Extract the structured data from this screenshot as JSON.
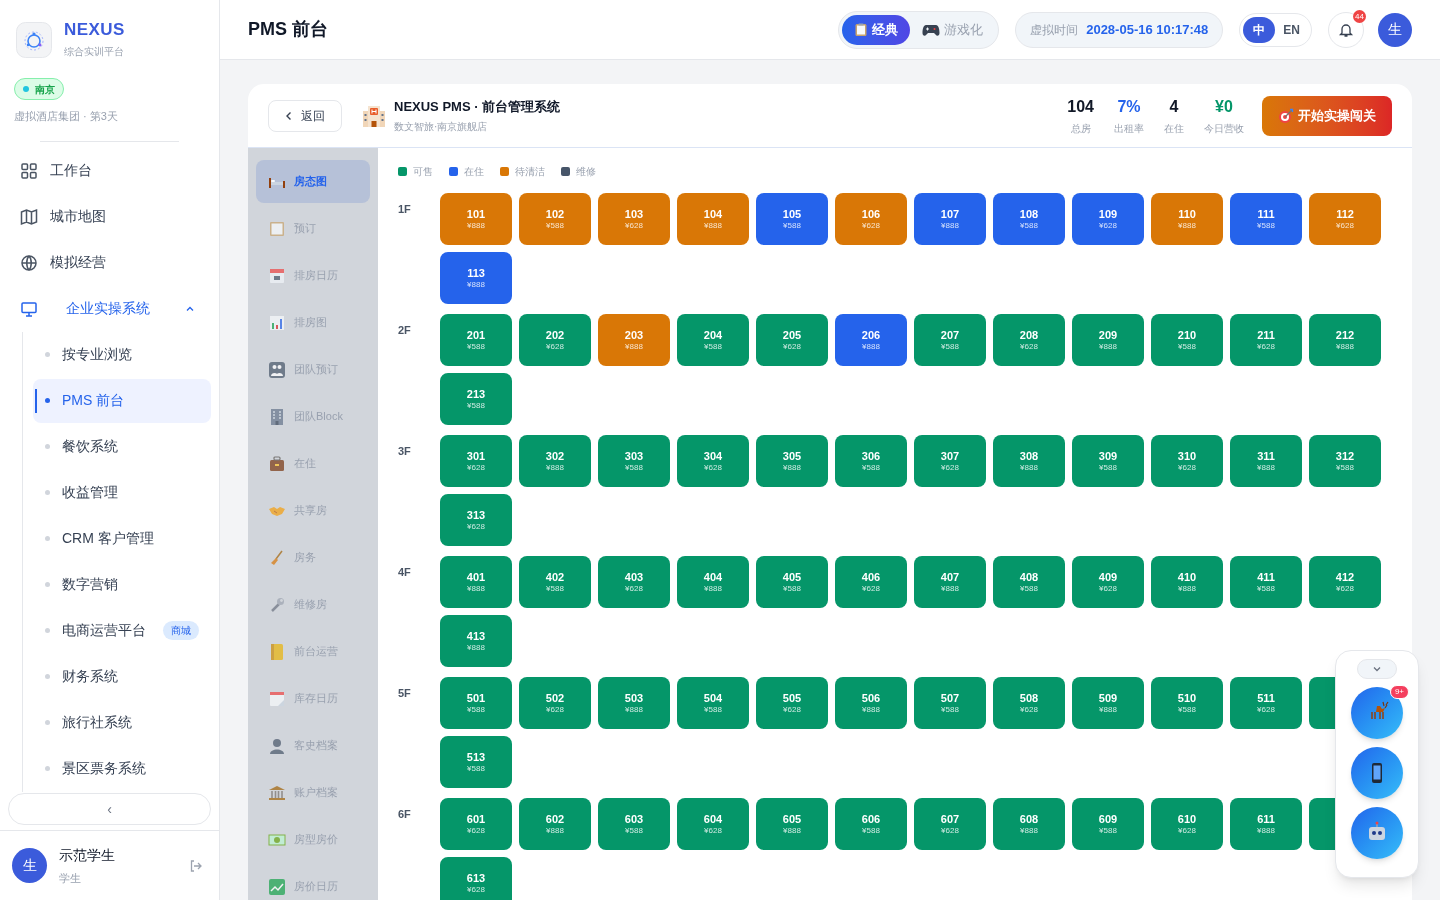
{
  "brand": {
    "name": "NEXUS",
    "subtitle": "综合实训平台"
  },
  "city": {
    "label": "南京",
    "caption": "虚拟酒店集团 · 第3天"
  },
  "nav": [
    {
      "label": "工作台"
    },
    {
      "label": "城市地图"
    },
    {
      "label": "模拟经营"
    },
    {
      "label": "企业实操系统",
      "expanded": true,
      "children": [
        {
          "label": "按专业浏览",
          "selected": false
        },
        {
          "label": "PMS 前台",
          "selected": true
        },
        {
          "label": "餐饮系统",
          "selected": false
        },
        {
          "label": "收益管理",
          "selected": false
        },
        {
          "label": "CRM 客户管理",
          "selected": false
        },
        {
          "label": "数字营销",
          "selected": false
        },
        {
          "label": "电商运营平台",
          "selected": false,
          "badge": "商城"
        },
        {
          "label": "财务系统",
          "selected": false
        },
        {
          "label": "旅行社系统",
          "selected": false
        },
        {
          "label": "景区票务系统",
          "selected": false
        }
      ]
    }
  ],
  "collapse_button": "‹",
  "user": {
    "avatar": "生",
    "name": "示范学生",
    "role": "学生"
  },
  "page_title": "PMS 前台",
  "modes": [
    {
      "label": "经典",
      "selected": true
    },
    {
      "label": "游戏化",
      "selected": false
    }
  ],
  "virtual_time": {
    "label": "虚拟时间",
    "value": "2028-05-16 10:17:48"
  },
  "languages": [
    {
      "label": "中",
      "selected": true
    },
    {
      "label": "EN",
      "selected": false
    }
  ],
  "notifications": {
    "count": "44"
  },
  "avatar": "生",
  "pms": {
    "back": "返回",
    "title": "NEXUS PMS · 前台管理系统",
    "subtitle": "数文智旅·南京旗舰店",
    "stats": [
      {
        "value": "104",
        "label": "总房",
        "color": "#111827"
      },
      {
        "value": "7%",
        "label": "出租率",
        "color": "#2563eb"
      },
      {
        "value": "4",
        "label": "在住",
        "color": "#111827"
      },
      {
        "value": "¥0",
        "label": "今日营收",
        "color": "#059669"
      }
    ],
    "start_button": "开始实操闯关",
    "menu": [
      {
        "label": "房态图",
        "selected": true
      },
      {
        "label": "预订",
        "selected": false
      },
      {
        "label": "排房日历",
        "selected": false
      },
      {
        "label": "排房图",
        "selected": false
      },
      {
        "label": "团队预订",
        "selected": false
      },
      {
        "label": "团队Block",
        "selected": false
      },
      {
        "label": "在住",
        "selected": false
      },
      {
        "label": "共享房",
        "selected": false
      },
      {
        "label": "房务",
        "selected": false
      },
      {
        "label": "维修房",
        "selected": false
      },
      {
        "label": "前台运营",
        "selected": false
      },
      {
        "label": "库存日历",
        "selected": false
      },
      {
        "label": "客史档案",
        "selected": false
      },
      {
        "label": "账户档案",
        "selected": false
      },
      {
        "label": "房型房价",
        "selected": false
      },
      {
        "label": "房价日历",
        "selected": false
      }
    ],
    "legend": [
      {
        "label": "可售",
        "color": "#059669"
      },
      {
        "label": "在住",
        "color": "#2563eb"
      },
      {
        "label": "待清洁",
        "color": "#d97706"
      },
      {
        "label": "维修",
        "color": "#475569"
      }
    ],
    "floors": [
      {
        "label": "1F",
        "rooms": [
          {
            "number": "101",
            "price": "¥888",
            "color": "#d97706"
          },
          {
            "number": "102",
            "price": "¥588",
            "color": "#d97706"
          },
          {
            "number": "103",
            "price": "¥628",
            "color": "#d97706"
          },
          {
            "number": "104",
            "price": "¥888",
            "color": "#d97706"
          },
          {
            "number": "105",
            "price": "¥588",
            "color": "#2563eb"
          },
          {
            "number": "106",
            "price": "¥628",
            "color": "#d97706"
          },
          {
            "number": "107",
            "price": "¥888",
            "color": "#2563eb"
          },
          {
            "number": "108",
            "price": "¥588",
            "color": "#2563eb"
          },
          {
            "number": "109",
            "price": "¥628",
            "color": "#2563eb"
          },
          {
            "number": "110",
            "price": "¥888",
            "color": "#d97706"
          },
          {
            "number": "111",
            "price": "¥588",
            "color": "#2563eb"
          },
          {
            "number": "112",
            "price": "¥628",
            "color": "#d97706"
          },
          {
            "number": "113",
            "price": "¥888",
            "color": "#2563eb"
          }
        ]
      },
      {
        "label": "2F",
        "rooms": [
          {
            "number": "201",
            "price": "¥588",
            "color": "#059669"
          },
          {
            "number": "202",
            "price": "¥628",
            "color": "#059669"
          },
          {
            "number": "203",
            "price": "¥888",
            "color": "#d97706"
          },
          {
            "number": "204",
            "price": "¥588",
            "color": "#059669"
          },
          {
            "number": "205",
            "price": "¥628",
            "color": "#059669"
          },
          {
            "number": "206",
            "price": "¥888",
            "color": "#2563eb"
          },
          {
            "number": "207",
            "price": "¥588",
            "color": "#059669"
          },
          {
            "number": "208",
            "price": "¥628",
            "color": "#059669"
          },
          {
            "number": "209",
            "price": "¥888",
            "color": "#059669"
          },
          {
            "number": "210",
            "price": "¥588",
            "color": "#059669"
          },
          {
            "number": "211",
            "price": "¥628",
            "color": "#059669"
          },
          {
            "number": "212",
            "price": "¥888",
            "color": "#059669"
          },
          {
            "number": "213",
            "price": "¥588",
            "color": "#059669"
          }
        ]
      },
      {
        "label": "3F",
        "rooms": [
          {
            "number": "301",
            "price": "¥628",
            "color": "#059669"
          },
          {
            "number": "302",
            "price": "¥888",
            "color": "#059669"
          },
          {
            "number": "303",
            "price": "¥588",
            "color": "#059669"
          },
          {
            "number": "304",
            "price": "¥628",
            "color": "#059669"
          },
          {
            "number": "305",
            "price": "¥888",
            "color": "#059669"
          },
          {
            "number": "306",
            "price": "¥588",
            "color": "#059669"
          },
          {
            "number": "307",
            "price": "¥628",
            "color": "#059669"
          },
          {
            "number": "308",
            "price": "¥888",
            "color": "#059669"
          },
          {
            "number": "309",
            "price": "¥588",
            "color": "#059669"
          },
          {
            "number": "310",
            "price": "¥628",
            "color": "#059669"
          },
          {
            "number": "311",
            "price": "¥888",
            "color": "#059669"
          },
          {
            "number": "312",
            "price": "¥588",
            "color": "#059669"
          },
          {
            "number": "313",
            "price": "¥628",
            "color": "#059669"
          }
        ]
      },
      {
        "label": "4F",
        "rooms": [
          {
            "number": "401",
            "price": "¥888",
            "color": "#059669"
          },
          {
            "number": "402",
            "price": "¥588",
            "color": "#059669"
          },
          {
            "number": "403",
            "price": "¥628",
            "color": "#059669"
          },
          {
            "number": "404",
            "price": "¥888",
            "color": "#059669"
          },
          {
            "number": "405",
            "price": "¥588",
            "color": "#059669"
          },
          {
            "number": "406",
            "price": "¥628",
            "color": "#059669"
          },
          {
            "number": "407",
            "price": "¥888",
            "color": "#059669"
          },
          {
            "number": "408",
            "price": "¥588",
            "color": "#059669"
          },
          {
            "number": "409",
            "price": "¥628",
            "color": "#059669"
          },
          {
            "number": "410",
            "price": "¥888",
            "color": "#059669"
          },
          {
            "number": "411",
            "price": "¥588",
            "color": "#059669"
          },
          {
            "number": "412",
            "price": "¥628",
            "color": "#059669"
          },
          {
            "number": "413",
            "price": "¥888",
            "color": "#059669"
          }
        ]
      },
      {
        "label": "5F",
        "rooms": [
          {
            "number": "501",
            "price": "¥588",
            "color": "#059669"
          },
          {
            "number": "502",
            "price": "¥628",
            "color": "#059669"
          },
          {
            "number": "503",
            "price": "¥888",
            "color": "#059669"
          },
          {
            "number": "504",
            "price": "¥588",
            "color": "#059669"
          },
          {
            "number": "505",
            "price": "¥628",
            "color": "#059669"
          },
          {
            "number": "506",
            "price": "¥888",
            "color": "#059669"
          },
          {
            "number": "507",
            "price": "¥588",
            "color": "#059669"
          },
          {
            "number": "508",
            "price": "¥628",
            "color": "#059669"
          },
          {
            "number": "509",
            "price": "¥888",
            "color": "#059669"
          },
          {
            "number": "510",
            "price": "¥588",
            "color": "#059669"
          },
          {
            "number": "511",
            "price": "¥628",
            "color": "#059669"
          },
          {
            "color": "#059669"
          },
          {
            "number": "513",
            "price": "¥588",
            "color": "#059669"
          }
        ]
      },
      {
        "label": "6F",
        "rooms": [
          {
            "number": "601",
            "price": "¥628",
            "color": "#059669"
          },
          {
            "number": "602",
            "price": "¥888",
            "color": "#059669"
          },
          {
            "number": "603",
            "price": "¥588",
            "color": "#059669"
          },
          {
            "number": "604",
            "price": "¥628",
            "color": "#059669"
          },
          {
            "number": "605",
            "price": "¥888",
            "color": "#059669"
          },
          {
            "number": "606",
            "price": "¥588",
            "color": "#059669"
          },
          {
            "number": "607",
            "price": "¥628",
            "color": "#059669"
          },
          {
            "number": "608",
            "price": "¥888",
            "color": "#059669"
          },
          {
            "number": "609",
            "price": "¥588",
            "color": "#059669"
          },
          {
            "number": "610",
            "price": "¥628",
            "color": "#059669"
          },
          {
            "number": "611",
            "price": "¥888",
            "color": "#059669"
          },
          {
            "color": "#059669"
          },
          {
            "number": "613",
            "price": "¥628",
            "color": "#059669"
          }
        ]
      }
    ]
  },
  "float_panel": {
    "badge": "9+"
  }
}
